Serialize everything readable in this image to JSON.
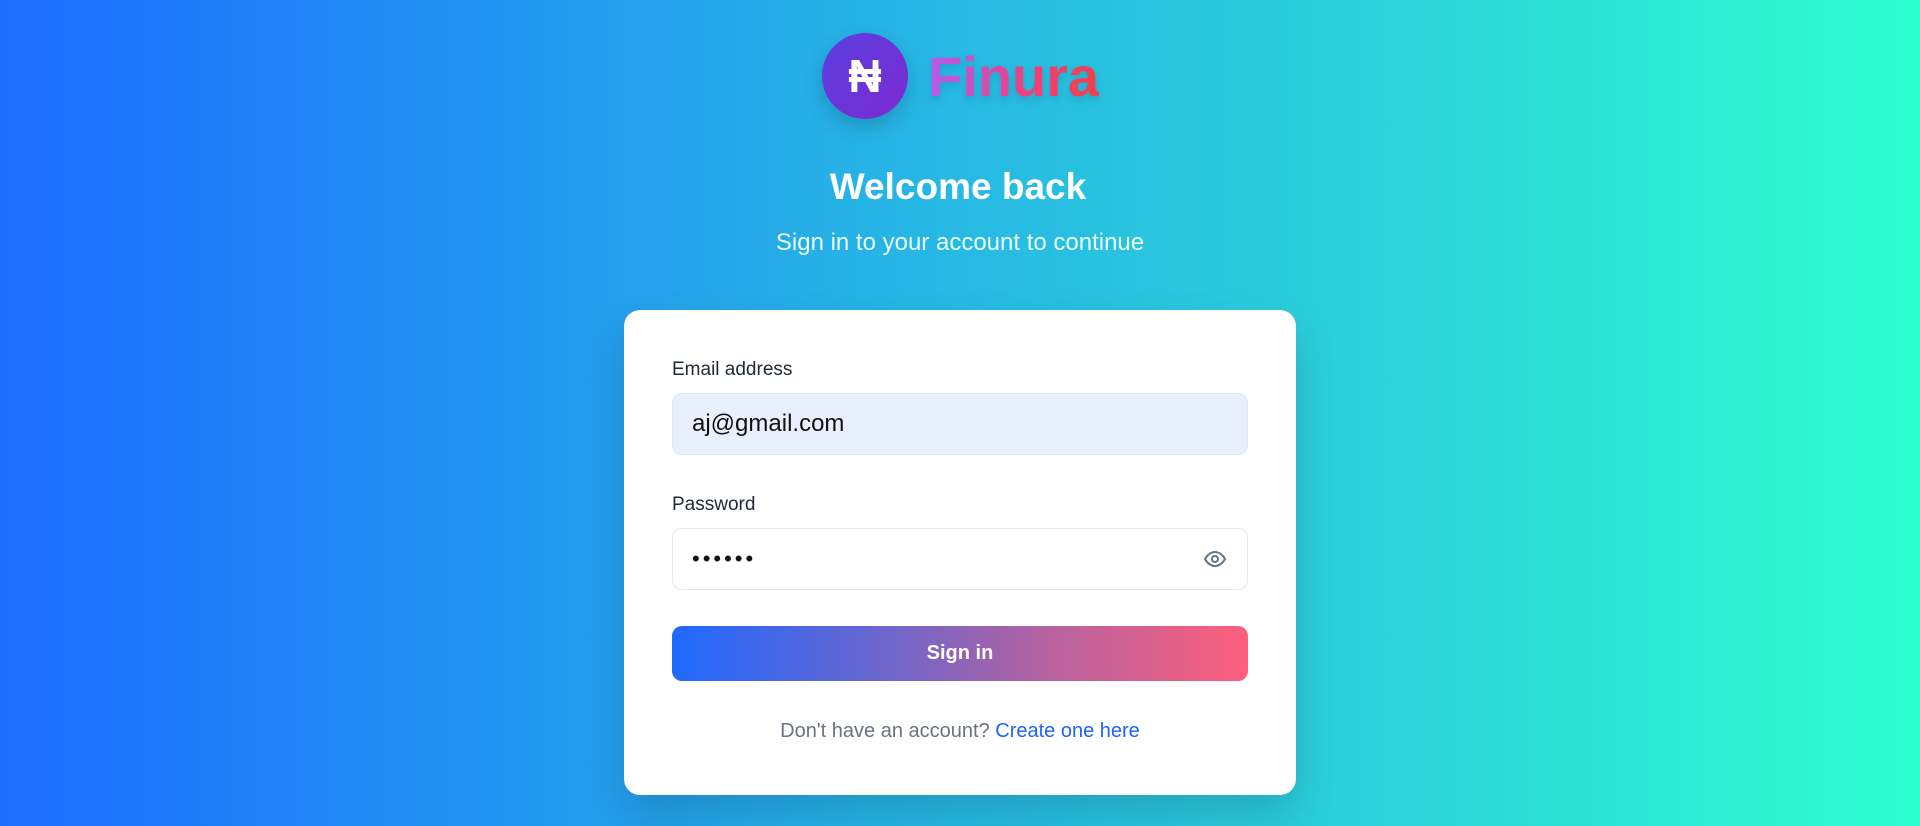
{
  "brand": {
    "name": "Finura",
    "icon_glyph": "₦"
  },
  "header": {
    "title": "Welcome back",
    "subtitle": "Sign in to your account to continue"
  },
  "form": {
    "email_label": "Email address",
    "email_value": "aj@gmail.com",
    "password_label": "Password",
    "password_value": "••••••",
    "submit_label": "Sign in",
    "footer_text": "Don't have an account?",
    "footer_link": "Create one here"
  },
  "colors": {
    "accent": "#1e63ff",
    "button_start": "#1e69ff",
    "button_end": "#fd5f7c"
  }
}
